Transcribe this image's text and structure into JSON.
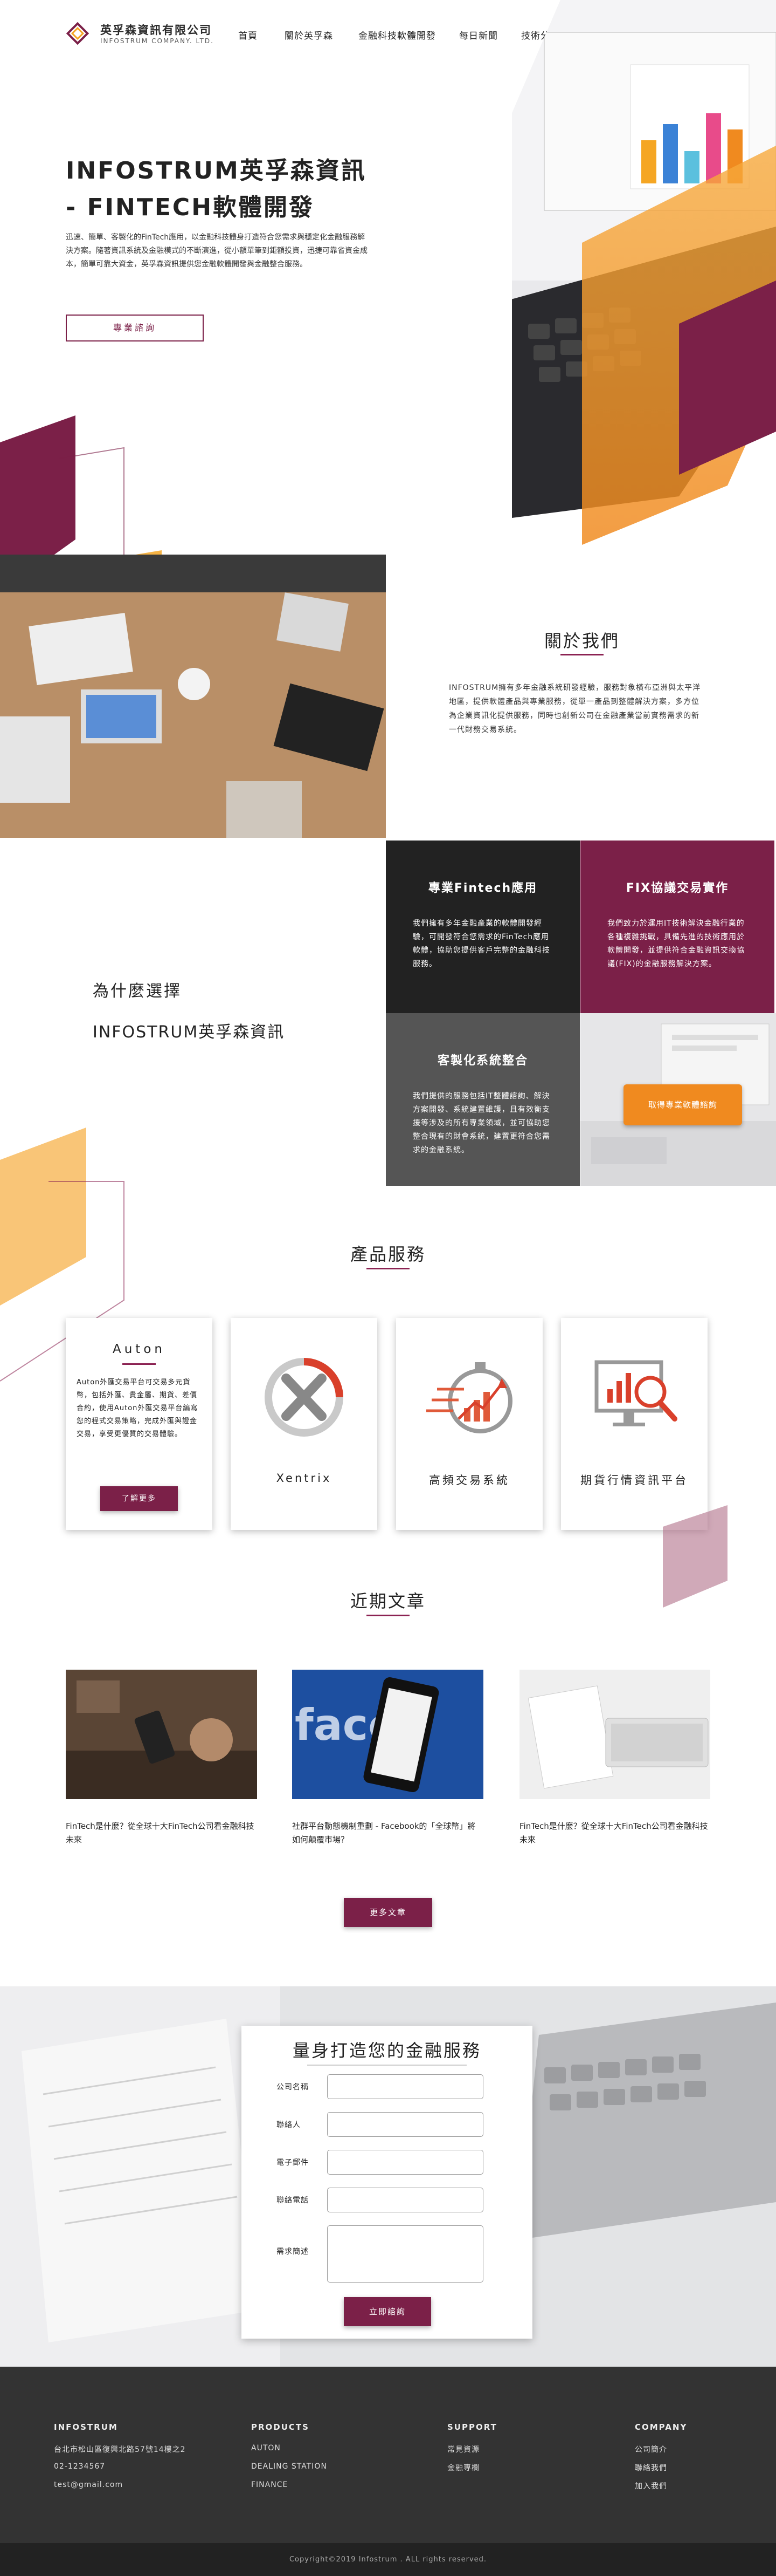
{
  "brand": {
    "name_cn": "英孚森資訊有限公司",
    "name_en": "INFOSTRUM COMPANY. LTD.",
    "primary_color": "#7b2048",
    "accent_color": "#f5a623"
  },
  "nav": {
    "items": [
      "首頁",
      "關於英孚森",
      "金融科技軟體開發",
      "每日新聞",
      "技術分享"
    ]
  },
  "hero": {
    "title_line1": "INFOSTRUM英孚森資訊",
    "title_line2": "- FINTECH軟體開發",
    "description": "迅速、簡單、客製化的FinTech應用，以金融科技體身打造符合您需求與穩定化金融服務解決方案。隨著資訊系統及金融模式的不斷演進，從小額單筆到鉅額投資，迅捷可靠省資金成本，簡單可靠大資金，英孚森資訊提供您金融軟體開發與金融整合服務。",
    "button": "專業諮詢"
  },
  "about": {
    "title": "關於我們",
    "description": "INFOSTRUM擁有多年金融系統研發經驗，服務對象橫布亞洲與太平洋地區，提供軟體產品與專業服務，從單一產品到整體解決方案，多方位為企業資訊化提供服務，同時也創新公司在金融產業當前實務需求的新一代財務交易系統。"
  },
  "why": {
    "title_line1": "為什麼選擇",
    "title_line2": "INFOSTRUM英孚森資訊",
    "boxes": [
      {
        "title": "專業Fintech應用",
        "text": "我們擁有多年金融產業的軟體開發經驗，可開發符合您需求的FinTech應用軟體，協助您提供客戶完整的金融科技服務。"
      },
      {
        "title": "FIX協議交易實作",
        "text": "我們致力於運用IT技術解決金融行業的各種複雜挑戰，具備先進的技術應用於軟體開發，並提供符合金融資訊交換協議(FIX)的金融服務解決方案。"
      },
      {
        "title": "客製化系統整合",
        "text": "我們提供的服務包括IT整體諮詢、解決方案開發、系統建置維護，且有效衡支援等涉及的所有專業領域，並可協助您整合現有的財會系統，建置更符合您需求的金融系統。"
      }
    ],
    "cta": "取得專業軟體諮詢"
  },
  "products": {
    "title": "產品服務",
    "auton": {
      "name": "Auton",
      "text": "Auton外匯交易平台可交易多元貨幣，包括外匯、貴金屬、期貨、差價合約，使用Auton外匯交易平台編寫您的程式交易策略，完成外匯與證金交易，享受更優質的交易體驗。",
      "button": "了解更多"
    },
    "items": [
      {
        "name": "Xentrix",
        "icon": "x-logo-icon"
      },
      {
        "name": "高頻交易系統",
        "icon": "stopwatch-chart-icon"
      },
      {
        "name": "期貨行情資訊平台",
        "icon": "monitor-magnifier-icon"
      }
    ]
  },
  "articles": {
    "title": "近期文章",
    "items": [
      {
        "text": "FinTech是什麼？從全球十大FinTech公司看金融科技未來"
      },
      {
        "text": "社群平台動態機制重劃 - Facebook的「全球幣」將如何顛覆市場？"
      },
      {
        "text": "FinTech是什麼？從全球十大FinTech公司看金融科技未來"
      }
    ],
    "button": "更多文章"
  },
  "contact": {
    "title": "量身打造您的金融服務",
    "fields": [
      "公司名稱",
      "聯絡人",
      "電子郵件",
      "聯絡電話",
      "需求簡述"
    ],
    "submit": "立即諮詢"
  },
  "footer": {
    "company": {
      "heading": "INFOSTRUM",
      "address": "台北市松山區復興北路57號14樓之2",
      "phone": "02-1234567",
      "email": "test@gmail.com"
    },
    "products": {
      "heading": "PRODUCTS",
      "items": [
        "AUTON",
        "DEALING STATION",
        "FINANCE"
      ]
    },
    "support": {
      "heading": "SUPPORT",
      "items": [
        "常見資源",
        "金融專欄"
      ]
    },
    "about": {
      "heading": "COMPANY",
      "items": [
        "公司簡介",
        "聯絡我們",
        "加入我們"
      ]
    },
    "copyright": "Copyright©2019 Infostrum . ALL rights reserved."
  }
}
